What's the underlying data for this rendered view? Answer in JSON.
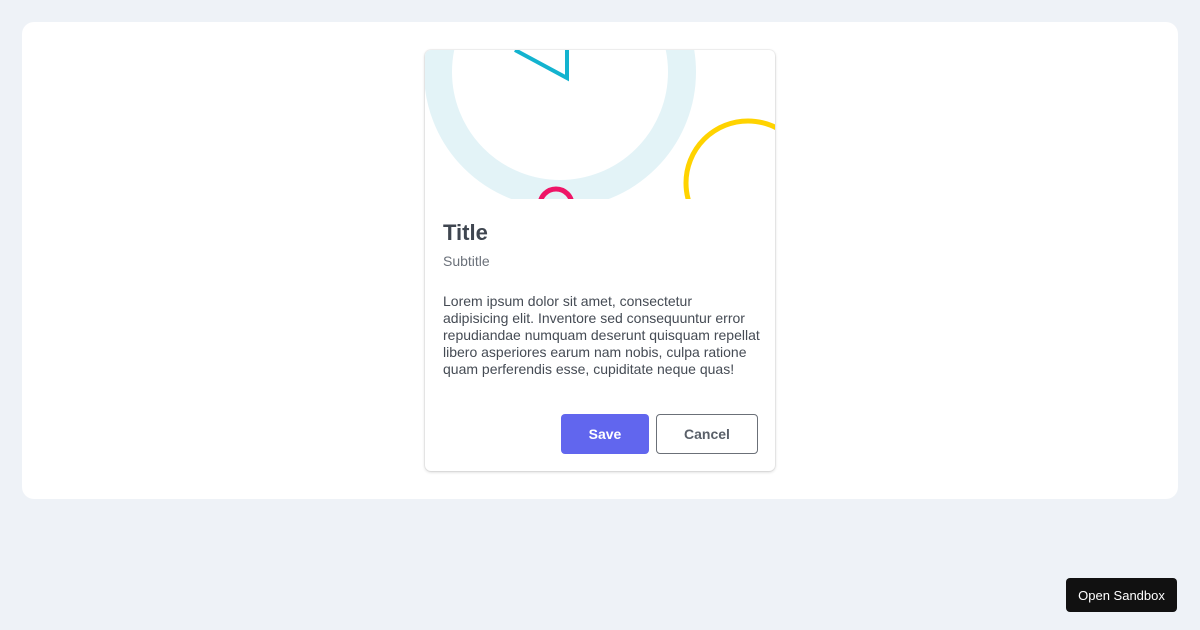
{
  "card": {
    "title": "Title",
    "subtitle": "Subtitle",
    "body": "Lorem ipsum dolor sit amet, consectetur adipisicing elit. Inventore sed consequuntur error repudiandae numquam deserunt quisquam repellat libero asperiores earum nam nobis, culpa ratione quam perferendis esse, cupiditate neque quas!",
    "actions": {
      "save_label": "Save",
      "cancel_label": "Cancel"
    },
    "media_colors": {
      "large_ring": "#e3f3f7",
      "triangle": "#13b3cf",
      "small_ring": "#ee1567",
      "yellow_ring": "#ffd300"
    }
  },
  "sandbox": {
    "label": "Open Sandbox"
  },
  "theme": {
    "page_background": "#eef2f7",
    "primary": "#6166ee"
  }
}
